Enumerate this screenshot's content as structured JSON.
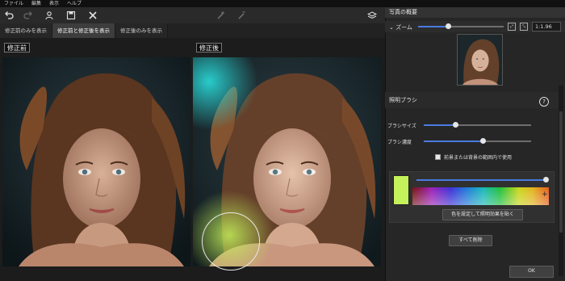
{
  "menu": [
    "ファイル",
    "編集",
    "表示",
    "ヘルプ"
  ],
  "view_tabs": [
    {
      "label": "修正前のみを表示",
      "active": false
    },
    {
      "label": "修正前と修正後を表示",
      "active": true
    },
    {
      "label": "修正後のみを表示",
      "active": false
    }
  ],
  "canvas": {
    "before_label": "修正前",
    "after_label": "修正後"
  },
  "preview_panel": {
    "title": "写真の概要",
    "zoom_label": "ズーム",
    "zoom_level": 0.35,
    "zoom_value": "1:1.96"
  },
  "brush_panel": {
    "title": "照明ブラシ",
    "help_icon": "?",
    "brush_size_label": "ブラシサイズ",
    "brush_size": 0.3,
    "brush_feather_label": "ブラシ濃度",
    "brush_feather": 0.55,
    "restrict_label": "前景または背景の範囲内で使用",
    "color_slider": 1.0,
    "swatch_color": "#c4f25a",
    "pick_color_button": "色を設定して照明効果を貼く",
    "delete_all_button": "すべて削除",
    "ok_button": "OK"
  },
  "colors": {
    "accent": "#4a7be0",
    "brush_glow": "#c4f25a",
    "cyan_glow": "#2ad4d4"
  }
}
